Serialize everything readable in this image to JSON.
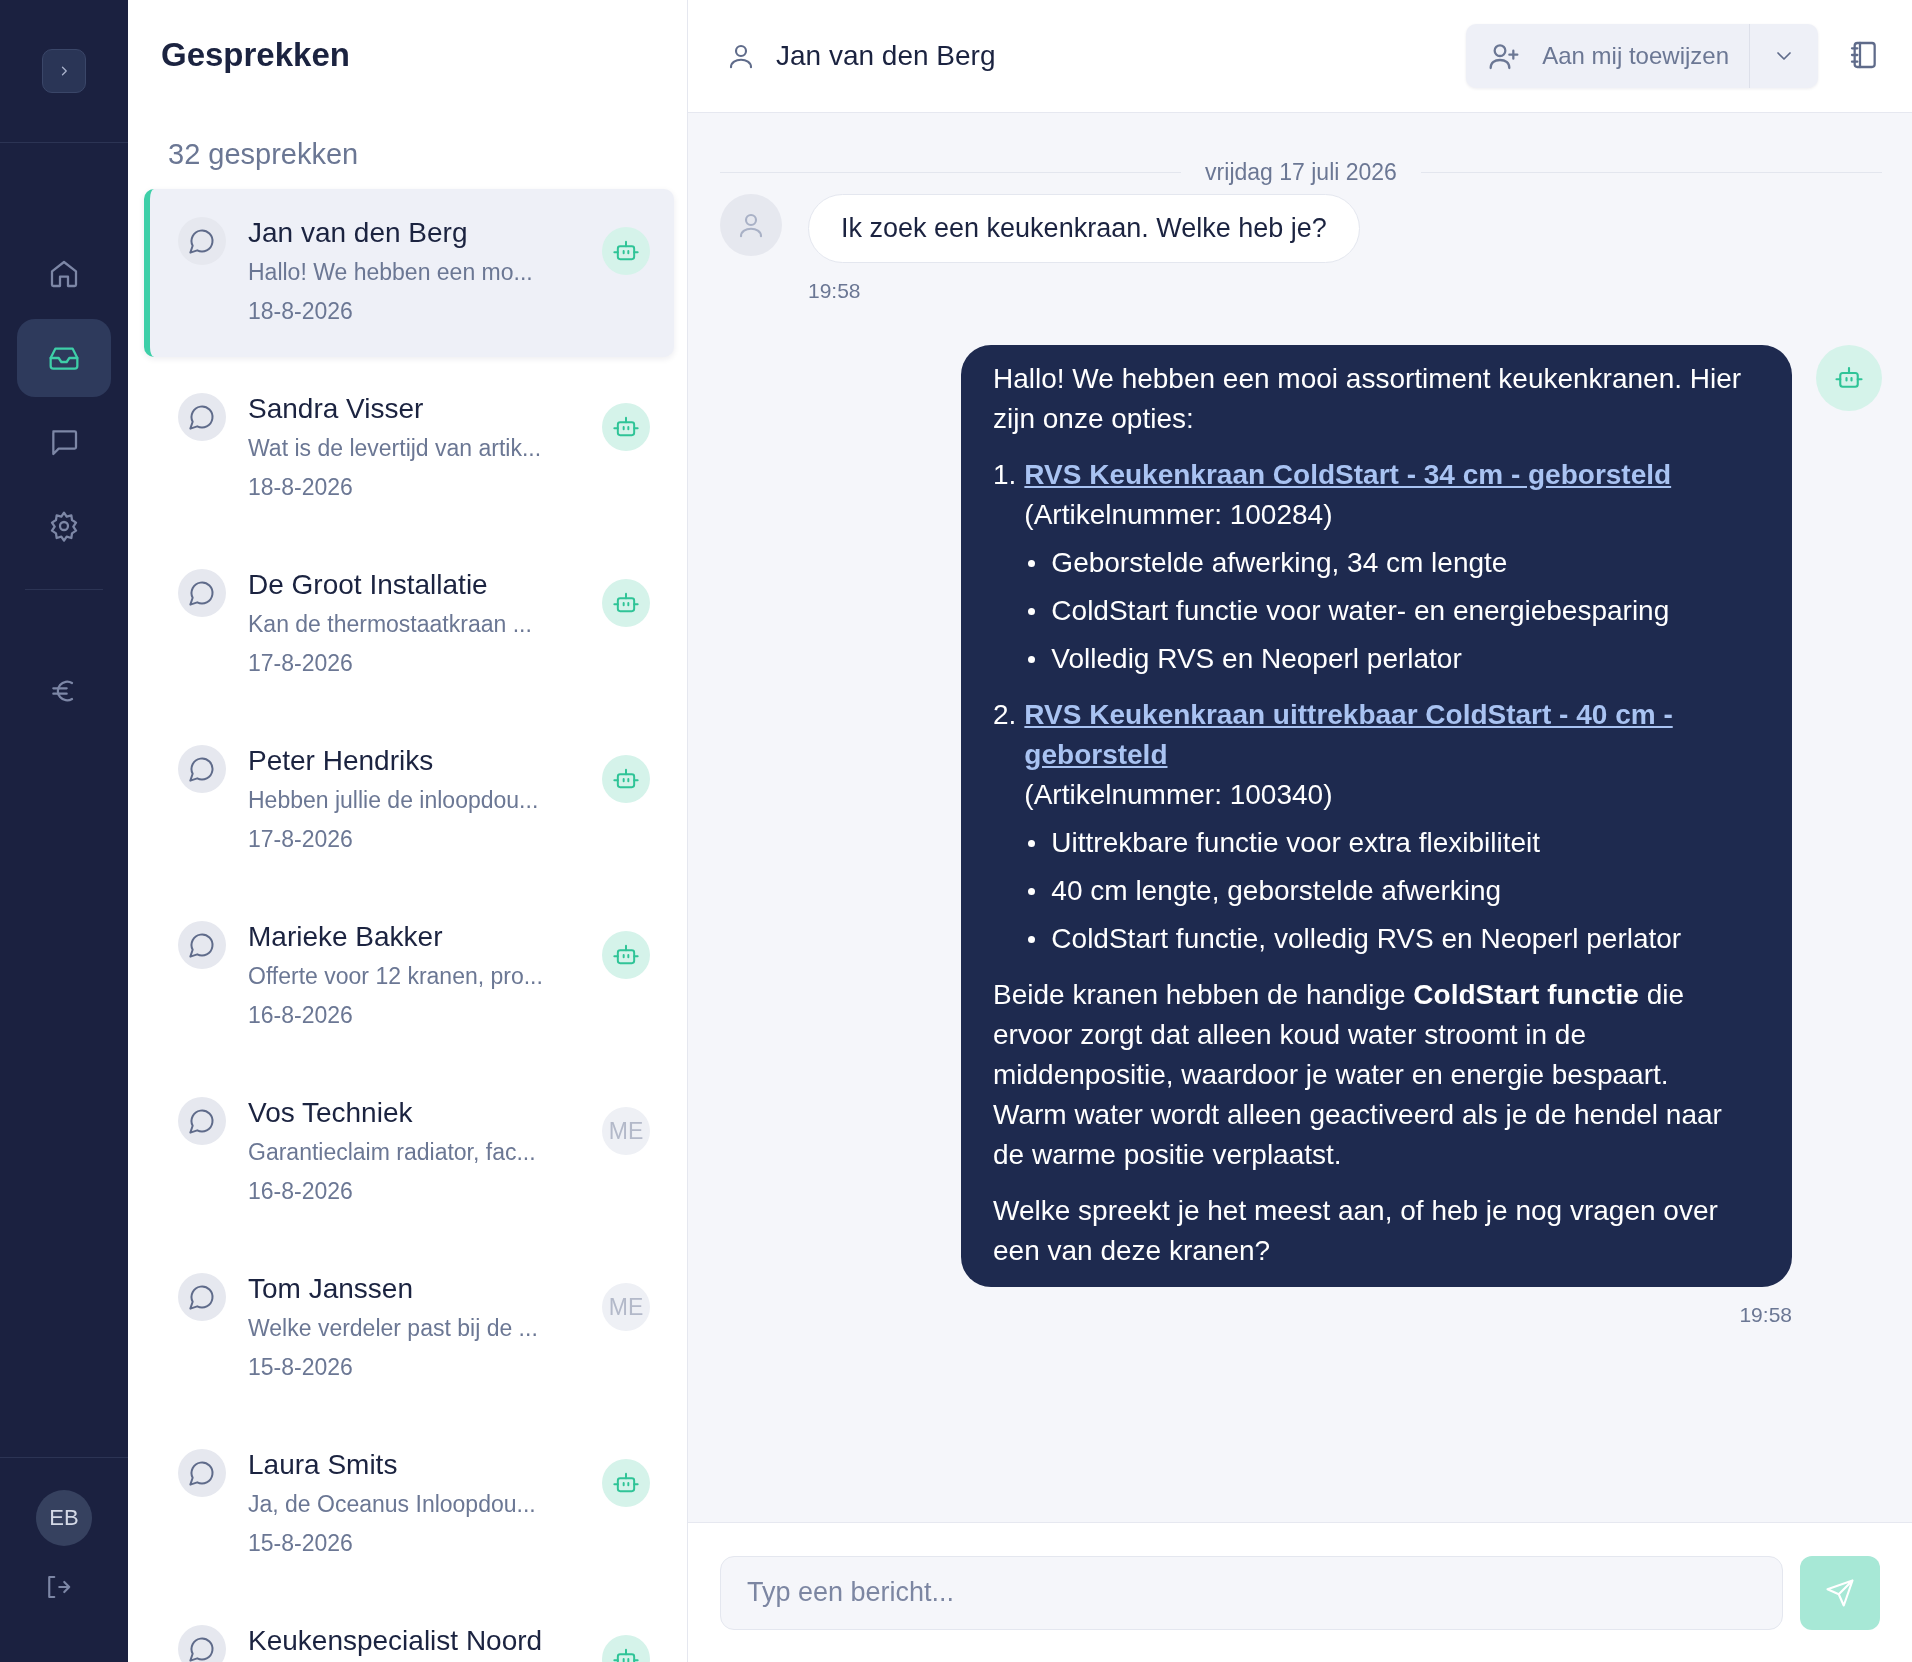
{
  "nav": {
    "primary": [
      {
        "kind": "home",
        "selected": false
      },
      {
        "kind": "inbox",
        "selected": true
      },
      {
        "kind": "chat",
        "selected": false
      },
      {
        "kind": "settings",
        "selected": false
      }
    ],
    "secondary": [
      {
        "kind": "euro",
        "selected": false
      }
    ],
    "user_initials": "EB"
  },
  "conversation_list": {
    "title": "Gesprekken",
    "count": "32 gesprekken",
    "conversations": [
      {
        "name": "Jan van den Berg",
        "preview": "Hallo! We hebben een mo...",
        "date": "18-8-2026",
        "selected": true,
        "kind": "bot"
      },
      {
        "name": "Sandra Visser",
        "preview": "Wat is de levertijd van artik...",
        "date": "18-8-2026",
        "selected": false,
        "kind": "bot"
      },
      {
        "name": "De Groot Installatie",
        "preview": "Kan de thermostaatkraan ...",
        "date": "17-8-2026",
        "selected": false,
        "kind": "bot"
      },
      {
        "name": "Peter Hendriks",
        "preview": "Hebben jullie de inloopdou...",
        "date": "17-8-2026",
        "selected": false,
        "kind": "bot"
      },
      {
        "name": "Marieke Bakker",
        "preview": "Offerte voor 12 kranen, pro...",
        "date": "16-8-2026",
        "selected": false,
        "kind": "bot"
      },
      {
        "name": "Vos Techniek",
        "preview": "Garantieclaim radiator, fac...",
        "date": "16-8-2026",
        "selected": false,
        "kind": "agent",
        "initials": "ME"
      },
      {
        "name": "Tom Janssen",
        "preview": "Welke verdeler past bij de ...",
        "date": "15-8-2026",
        "selected": false,
        "kind": "agent",
        "initials": "ME"
      },
      {
        "name": "Laura Smits",
        "preview": "Ja, de Oceanus Inloopdou...",
        "date": "15-8-2026",
        "selected": false,
        "kind": "bot"
      },
      {
        "name": "Keukenspecialist Noord",
        "selected": false,
        "kind": "bot"
      }
    ]
  },
  "chat": {
    "contact_name": "Jan van den Berg",
    "assign_button": "Aan mij toewijzen",
    "date_divider": "vrijdag 17 juli 2026",
    "messages": [
      {
        "kind": "user",
        "text": "Ik zoek een keukenkraan. Welke heb je?",
        "time": "19:58"
      },
      {
        "kind": "bot",
        "time": "19:58",
        "blocks": [
          {
            "kind": "paragraph",
            "text": "Hallo! We hebben een mooi assortiment keukenkranen. Hier zijn onze opties:"
          },
          {
            "kind": "ordered_list",
            "items": [
              {
                "number": "1.",
                "link": "RVS Keukenkraan ColdStart - 34 cm - geborsteld",
                "text": "(Artikelnummer: 100284)",
                "bullets": [
                  "Geborstelde afwerking, 34 cm lengte",
                  "ColdStart functie voor water- en energiebesparing",
                  "Volledig RVS en Neoperl perlator"
                ]
              },
              {
                "number": "2.",
                "link": "RVS Keukenkraan uittrekbaar ColdStart - 40 cm - geborsteld",
                "text": "(Artikelnummer: 100340)",
                "bullets": [
                  "Uittrekbare functie voor extra flexibiliteit",
                  "40 cm lengte, geborstelde afwerking",
                  "ColdStart functie, volledig RVS en Neoperl perlator"
                ]
              }
            ]
          },
          {
            "kind": "paragraph",
            "text": "Beide kranen hebben de handige **ColdStart functie** die ervoor zorgt dat alleen koud water stroomt in de middenpositie, waardoor je water en energie bespaart. Warm water wordt alleen geactiveerd als je de hendel naar de warme positie verplaatst."
          },
          {
            "kind": "paragraph",
            "text": "Welke spreekt je het meest aan, of heb je nog vragen over een van deze kranen?"
          }
        ]
      }
    ],
    "input_placeholder": "Typ een bericht..."
  }
}
